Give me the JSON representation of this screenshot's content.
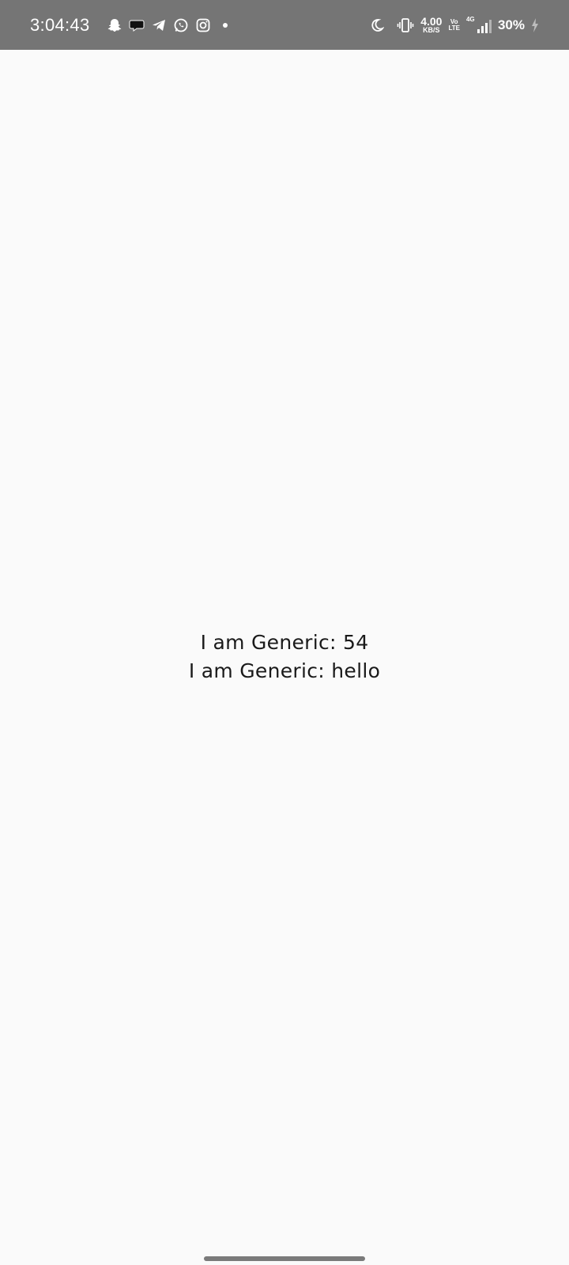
{
  "status_bar": {
    "time": "3:04:43",
    "notification_icons": [
      "snapchat-icon",
      "chat-bubble-icon",
      "telegram-icon",
      "whatsapp-icon",
      "instagram-icon"
    ],
    "net_speed_value": "4.00",
    "net_speed_unit": "KB/S",
    "volte_top": "Vo",
    "volte_bottom": "LTE",
    "signal_label": "4G",
    "battery": "30%",
    "background_color": "#757575"
  },
  "main": {
    "line1": "I am Generic: 54",
    "line2": "I am Generic: hello"
  },
  "background_color": "#fafafa"
}
